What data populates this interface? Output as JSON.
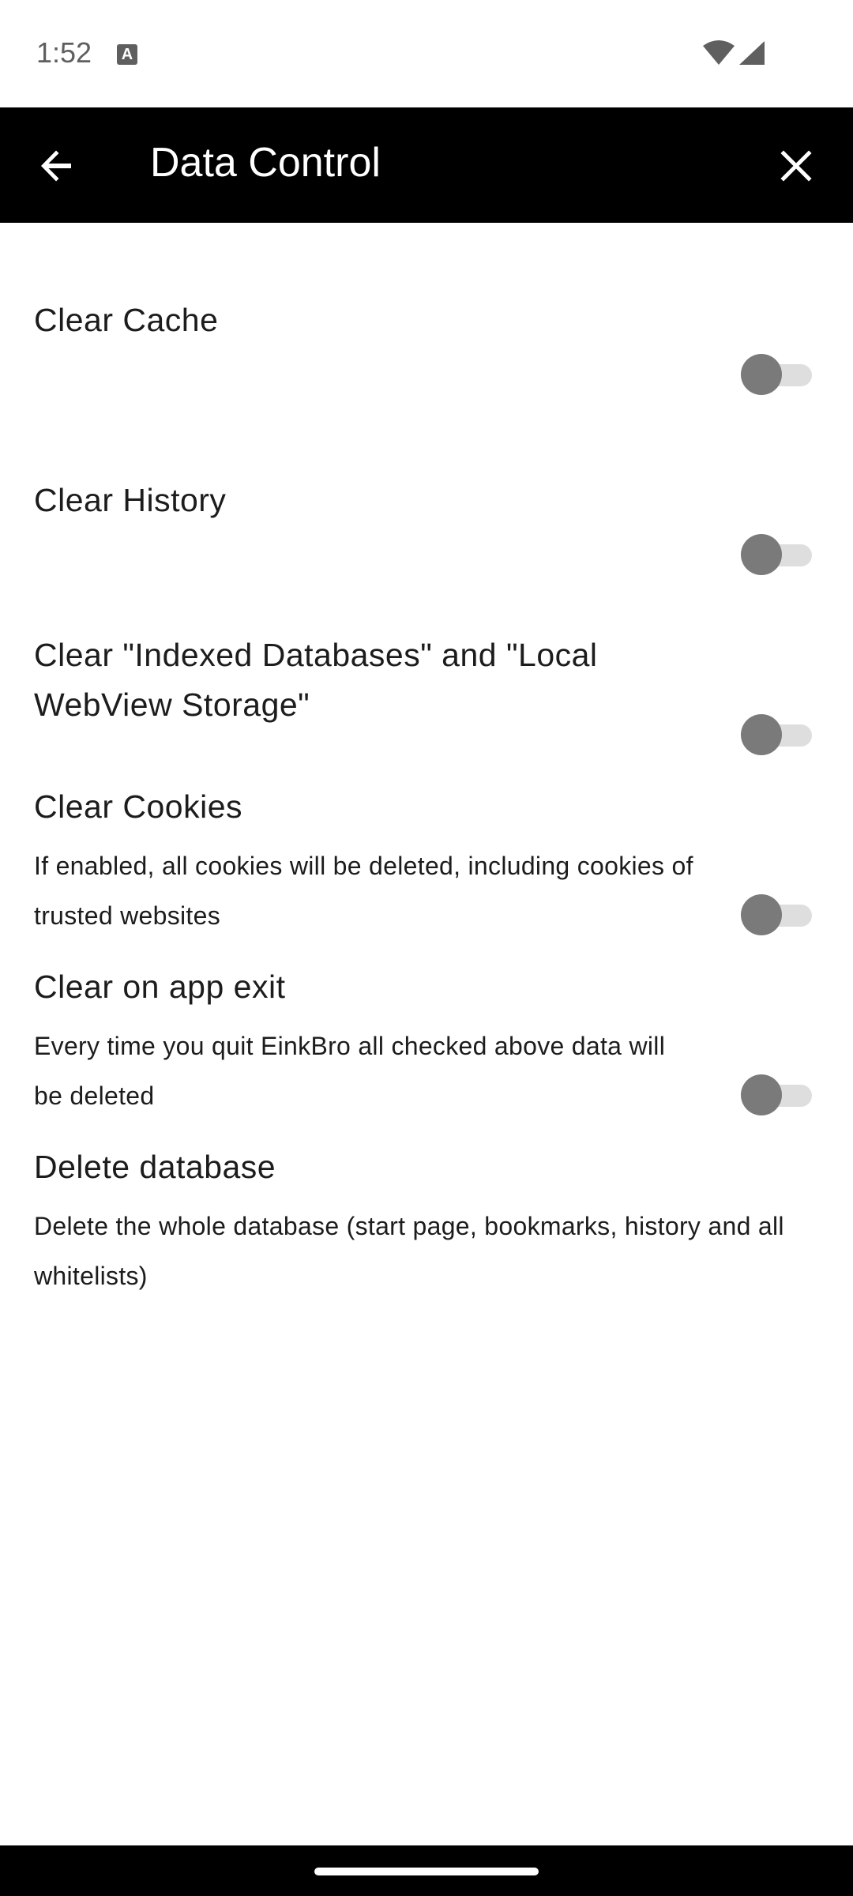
{
  "status_bar": {
    "time": "1:52",
    "icons": [
      "text-notification-icon",
      "wifi-icon",
      "cell-signal-icon"
    ]
  },
  "app_bar": {
    "title": "Data Control",
    "back_icon": "arrow-back-icon",
    "close_icon": "close-icon",
    "background": "#000000",
    "foreground": "#ffffff"
  },
  "preferences": [
    {
      "title": "Clear Cache",
      "summary": "",
      "has_switch": true,
      "checked": false
    },
    {
      "title": "Clear History",
      "summary": "",
      "has_switch": true,
      "checked": false
    },
    {
      "title": "Clear \"Indexed Databases\" and \"Local WebView Storage\"",
      "summary": "",
      "has_switch": true,
      "checked": false
    },
    {
      "title": "Clear Cookies",
      "summary": "If enabled, all cookies will be deleted, including cookies of trusted websites",
      "has_switch": true,
      "checked": false
    },
    {
      "title": "Clear on app exit",
      "summary": "Every time you quit EinkBro all checked above data will be deleted",
      "has_switch": true,
      "checked": false
    },
    {
      "title": "Delete database",
      "summary": "Delete the whole database (start page, bookmarks, history and all whitelists)",
      "has_switch": false
    }
  ],
  "colors": {
    "switch_track_off": "#dedede",
    "switch_thumb_off": "#7a7a7a",
    "text": "#1c1c1c"
  }
}
